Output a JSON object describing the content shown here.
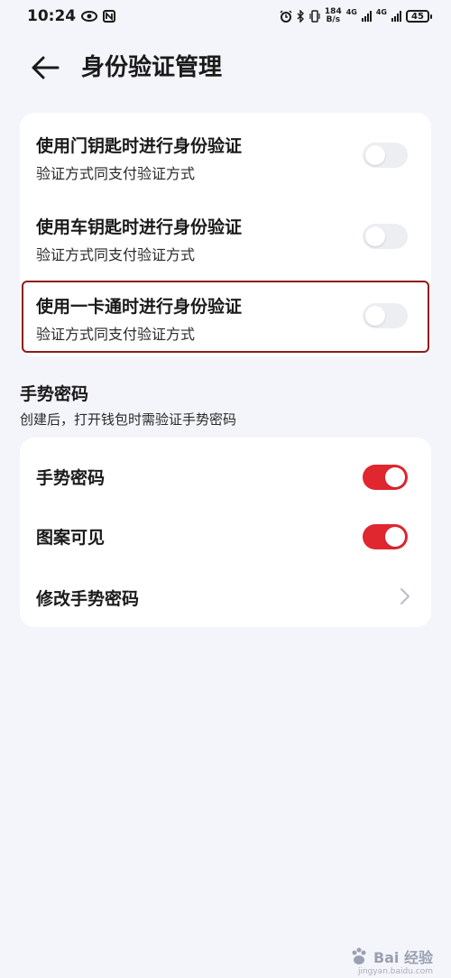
{
  "status_bar": {
    "time": "10:24",
    "net_speed_value": "184",
    "net_speed_unit": "B/s",
    "network_1": "4G",
    "network_2": "4G",
    "battery": "45"
  },
  "header": {
    "title": "身份验证管理"
  },
  "auth_card": {
    "items": [
      {
        "title": "使用门钥匙时进行身份验证",
        "subtitle": "验证方式同支付验证方式",
        "enabled": false
      },
      {
        "title": "使用车钥匙时进行身份验证",
        "subtitle": "验证方式同支付验证方式",
        "enabled": false
      },
      {
        "title": "使用一卡通时进行身份验证",
        "subtitle": "验证方式同支付验证方式",
        "enabled": false
      }
    ]
  },
  "gesture_section": {
    "title": "手势密码",
    "subtitle": "创建后，打开钱包时需验证手势密码",
    "items": [
      {
        "title": "手势密码",
        "enabled": true
      },
      {
        "title": "图案可见",
        "enabled": true
      },
      {
        "title": "修改手势密码"
      }
    ]
  },
  "watermark": {
    "text": "Bai 经验",
    "url": "jingyan.baidu.com"
  },
  "colors": {
    "accent": "#e0262f",
    "highlight_border": "#8e1b1b",
    "background": "#f4f5fa",
    "card": "#ffffff",
    "toggle_off": "#eceef2"
  }
}
